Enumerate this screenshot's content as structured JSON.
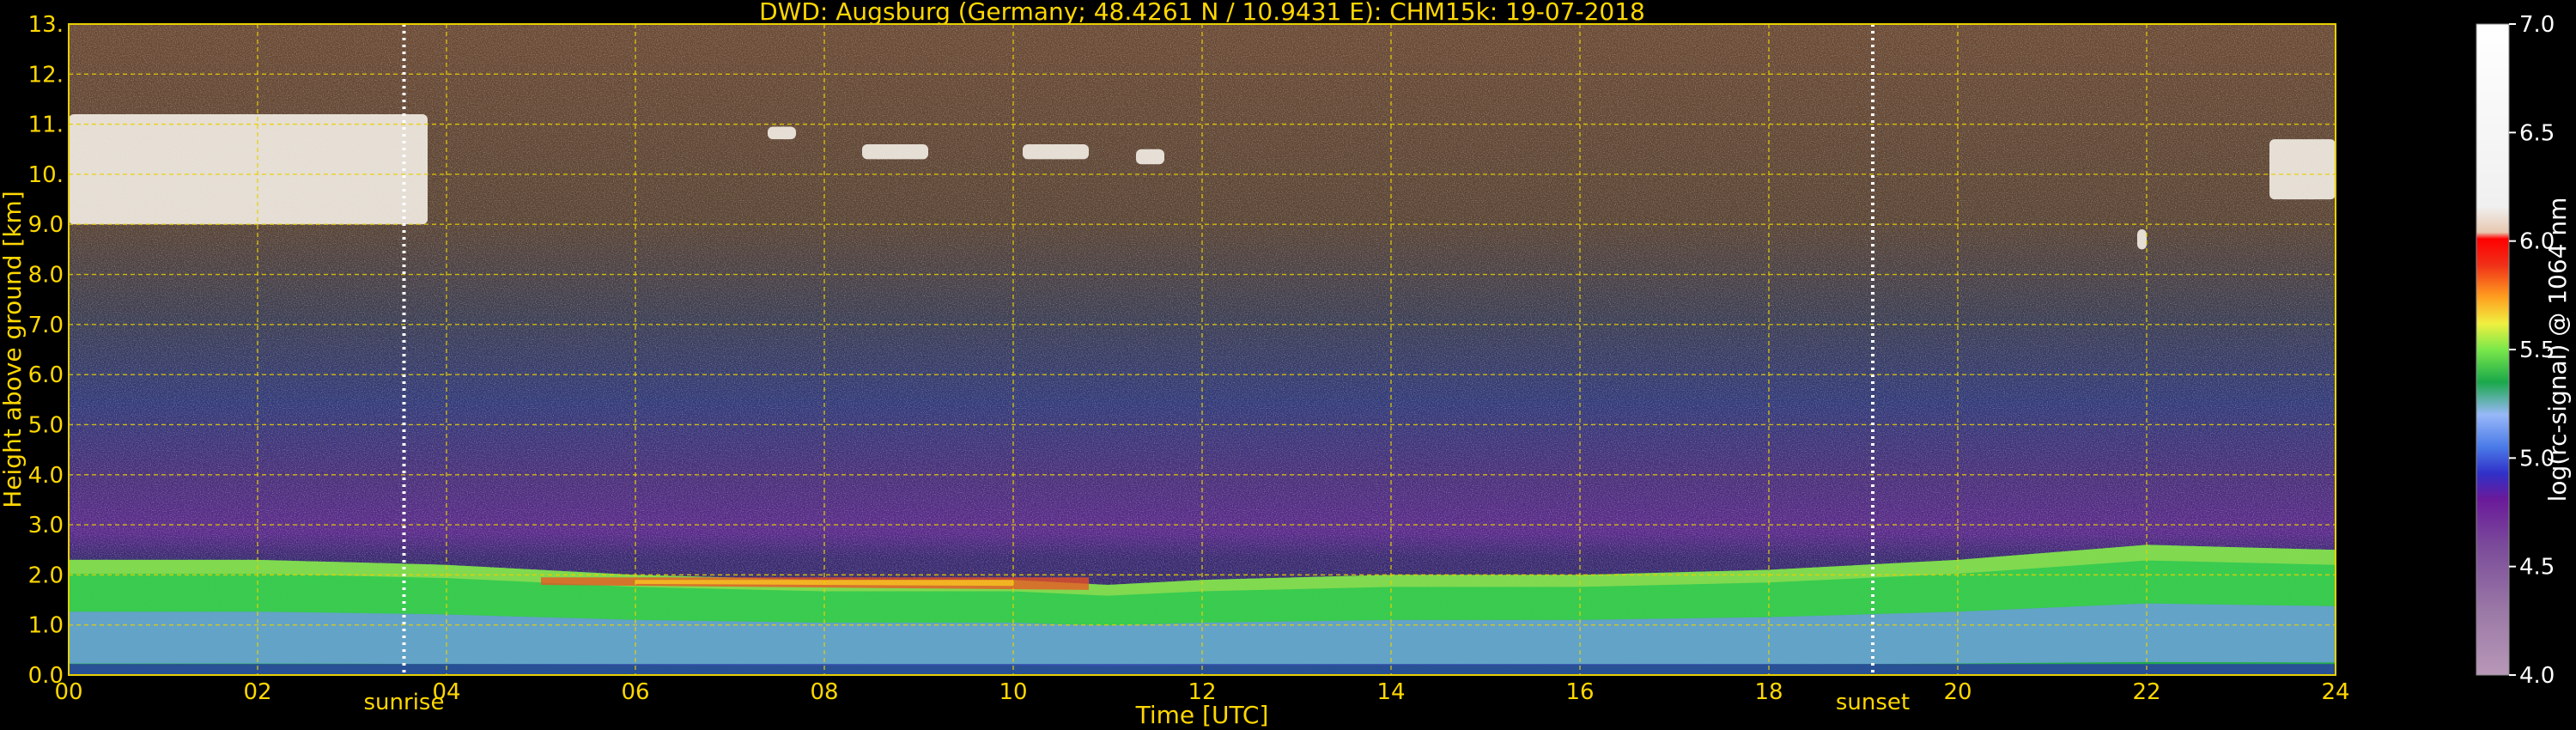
{
  "chart_data": {
    "type": "heatmap",
    "title": "DWD: Augsburg (Germany; 48.4261 N / 10.9431 E):    CHM15k: 19-07-2018",
    "xlabel": "Time [UTC]",
    "ylabel": "Height above ground [km]",
    "xlim": [
      0,
      24
    ],
    "ylim": [
      0,
      13
    ],
    "x_ticks": [
      "00",
      "02",
      "04",
      "06",
      "08",
      "10",
      "12",
      "14",
      "16",
      "18",
      "20",
      "22",
      "24"
    ],
    "y_ticks": [
      "0.0",
      "1.0",
      "2.0",
      "3.0",
      "4.0",
      "5.0",
      "6.0",
      "7.0",
      "8.0",
      "9.0",
      "10.",
      "11.",
      "12.",
      "13."
    ],
    "grid": true,
    "grid_color": "#e8d000",
    "sunrise": {
      "label": "sunrise",
      "time_utc": 3.55
    },
    "sunset": {
      "label": "sunset",
      "time_utc": 19.1
    },
    "colorbar": {
      "label": "log(rc-signal) @ 1064 nm",
      "range": [
        4.0,
        7.0
      ],
      "ticks": [
        "4.0",
        "4.5",
        "5.0",
        "5.5",
        "6.0",
        "6.5",
        "7.0"
      ]
    },
    "boundary_layer_top_km": [
      [
        0,
        2.3
      ],
      [
        2,
        2.3
      ],
      [
        4,
        2.2
      ],
      [
        6,
        2.0
      ],
      [
        8,
        1.9
      ],
      [
        10,
        1.9
      ],
      [
        11,
        1.8
      ],
      [
        12,
        1.9
      ],
      [
        14,
        2.0
      ],
      [
        16,
        2.0
      ],
      [
        18,
        2.1
      ],
      [
        20,
        2.3
      ],
      [
        22,
        2.6
      ],
      [
        24,
        2.5
      ]
    ],
    "clouds": [
      {
        "t0": 0.0,
        "t1": 3.8,
        "base_km": 9.0,
        "top_km": 11.2
      },
      {
        "t0": 7.4,
        "t1": 7.7,
        "base_km": 10.7,
        "top_km": 10.95
      },
      {
        "t0": 8.4,
        "t1": 9.1,
        "base_km": 10.3,
        "top_km": 10.6
      },
      {
        "t0": 10.1,
        "t1": 10.8,
        "base_km": 10.3,
        "top_km": 10.6
      },
      {
        "t0": 11.3,
        "t1": 11.6,
        "base_km": 10.2,
        "top_km": 10.5
      },
      {
        "t0": 21.9,
        "t1": 22.0,
        "base_km": 8.5,
        "top_km": 8.9
      },
      {
        "t0": 23.3,
        "t1": 24.0,
        "base_km": 9.5,
        "top_km": 10.7
      }
    ]
  }
}
